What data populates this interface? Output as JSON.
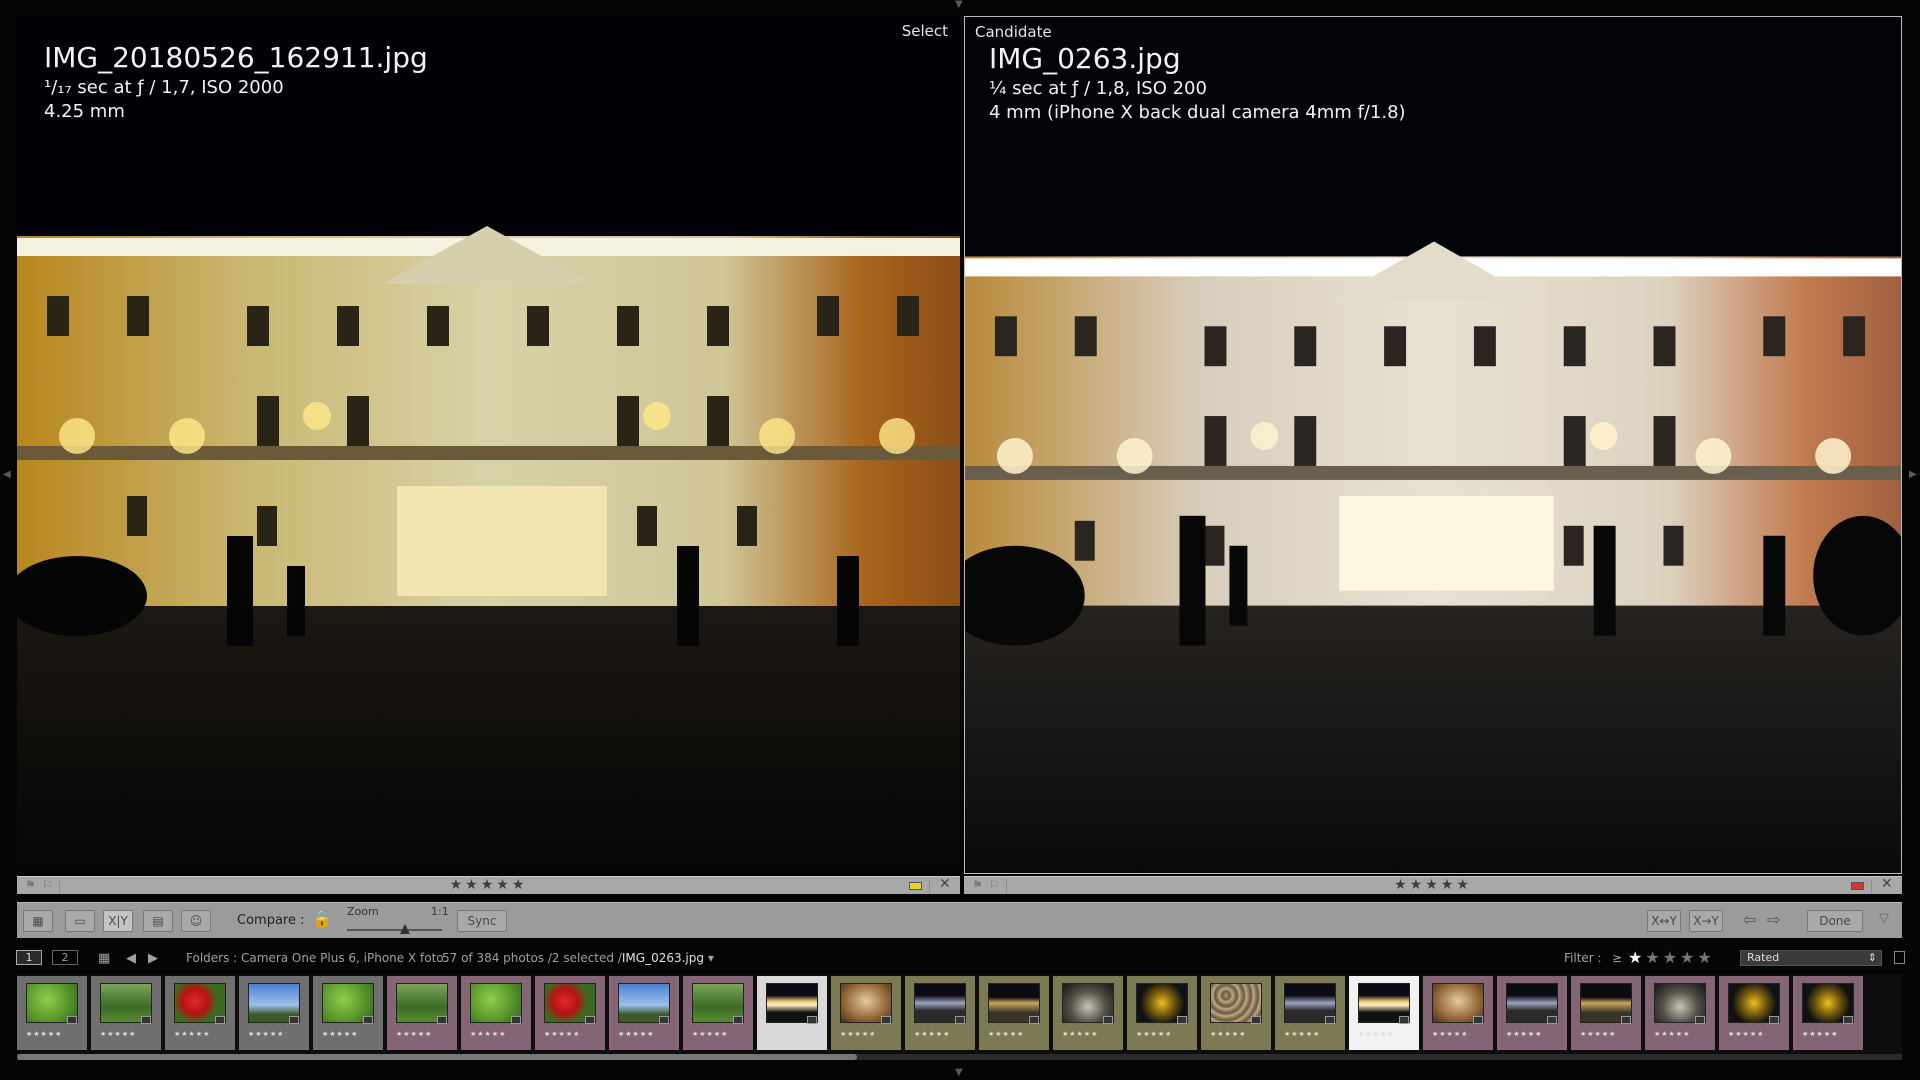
{
  "left_pane": {
    "tag": "Select",
    "filename": "IMG_20180526_162911.jpg",
    "exposure": "¹/₁₇ sec at ƒ / 1,7, ISO 2000",
    "focal": "4.25 mm",
    "rating": "★★★★★",
    "color_label": "#e8d61e"
  },
  "right_pane": {
    "tag": "Candidate",
    "filename": "IMG_0263.jpg",
    "exposure": "¼ sec at ƒ / 1,8, ISO 200",
    "focal": "4 mm (iPhone X back dual camera 4mm f/1.8)",
    "rating": "★★★★★",
    "color_label": "#e03030"
  },
  "toolbar": {
    "compare_label": "Compare :",
    "zoom_label": "Zoom",
    "zoom_value": "1:1",
    "sync_label": "Sync",
    "done_label": "Done",
    "swap_label": "X↔Y",
    "make_select_label": "X→Y"
  },
  "nav": {
    "monitor1": "1",
    "monitor2": "2",
    "breadcrumb": "Folders : Camera One Plus 6, iPhone X foto",
    "count": "57 of 384 photos /2 selected /",
    "current_file": "IMG_0263.jpg",
    "filter_label": "Filter :",
    "filter_ge": "≥",
    "filter_dropdown": "Rated"
  },
  "filmstrip": {
    "thumbs": [
      {
        "kind": "green",
        "frame": "#6f6f6f",
        "stars": "★★★★★"
      },
      {
        "kind": "green2",
        "frame": "#6f6f6f",
        "stars": "★★★★★"
      },
      {
        "kind": "red",
        "frame": "#6f6f6f",
        "stars": "★★★★★"
      },
      {
        "kind": "sky",
        "frame": "#6f6f6f",
        "stars": "★★★★★"
      },
      {
        "kind": "green",
        "frame": "#6f6f6f",
        "stars": "★★★★★"
      },
      {
        "kind": "green2",
        "frame": "#836575",
        "stars": "★★★★★"
      },
      {
        "kind": "green",
        "frame": "#836575",
        "stars": "★★★★★"
      },
      {
        "kind": "red",
        "frame": "#836575",
        "stars": "★★★★★"
      },
      {
        "kind": "sky",
        "frame": "#836575",
        "stars": "★★★★★"
      },
      {
        "kind": "green2",
        "frame": "#836575",
        "stars": "★★★★★"
      },
      {
        "kind": "palace",
        "frame": "#d9d9d9",
        "stars": "★★★★★"
      },
      {
        "kind": "statue",
        "frame": "#7b7a55",
        "stars": "★★★★★"
      },
      {
        "kind": "street",
        "frame": "#7b7a55",
        "stars": "★★★★★"
      },
      {
        "kind": "road",
        "frame": "#7b7a55",
        "stars": "★★★★★"
      },
      {
        "kind": "tunnel",
        "frame": "#7b7a55",
        "stars": "★★★★★"
      },
      {
        "kind": "flower",
        "frame": "#7b7a55",
        "stars": "★★★★★"
      },
      {
        "kind": "gravel",
        "frame": "#7b7a55",
        "stars": "★★★★★"
      },
      {
        "kind": "street",
        "frame": "#7b7a55",
        "stars": "★★★★★"
      },
      {
        "kind": "palace",
        "frame": "#f2f2f2",
        "stars": "★★★★★"
      },
      {
        "kind": "statue",
        "frame": "#836575",
        "stars": "★★★★★"
      },
      {
        "kind": "street",
        "frame": "#836575",
        "stars": "★★★★★"
      },
      {
        "kind": "road",
        "frame": "#836575",
        "stars": "★★★★★"
      },
      {
        "kind": "tunnel",
        "frame": "#836575",
        "stars": "★★★★★"
      },
      {
        "kind": "flower",
        "frame": "#836575",
        "stars": "★★★★★"
      },
      {
        "kind": "flower",
        "frame": "#836575",
        "stars": "★★★★★"
      }
    ]
  }
}
